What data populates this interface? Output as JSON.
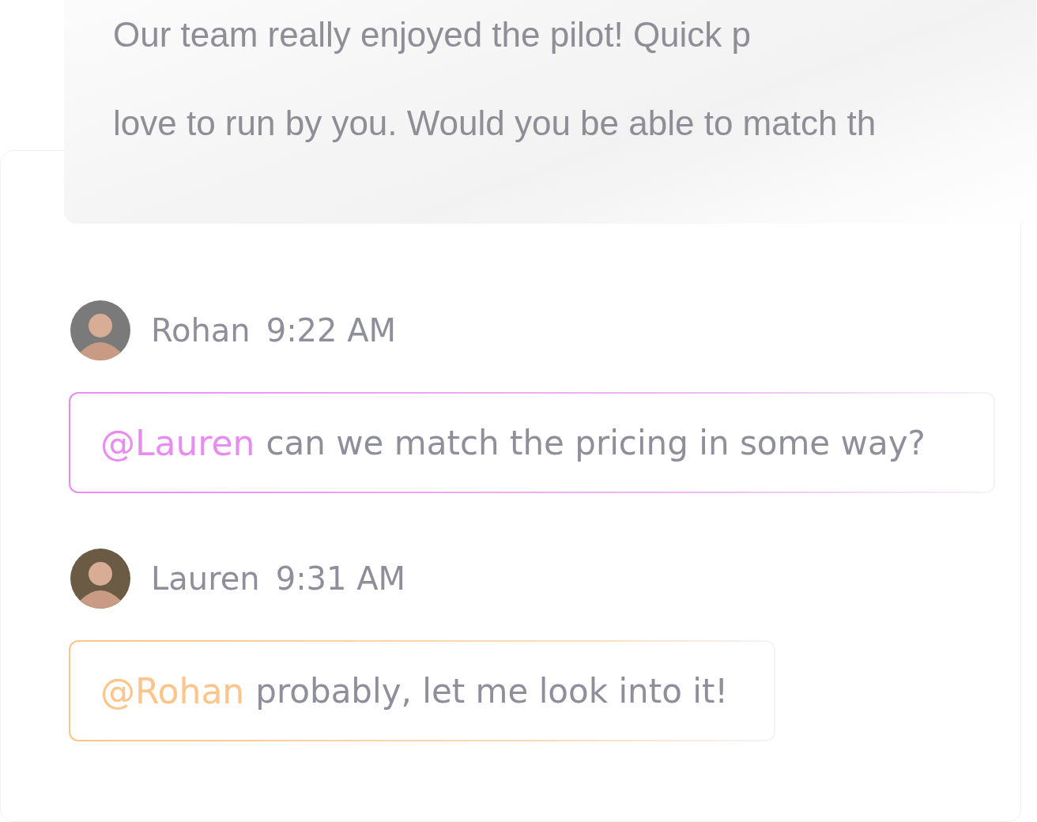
{
  "quoted_message": {
    "lines": [
      "Our team really enjoyed the pilot! Quick p",
      "love to run by you. Would you be able to match th"
    ]
  },
  "messages": [
    {
      "author": "Rohan",
      "time": "9:22 AM",
      "mention": "@Lauren",
      "text": "can we match the pricing in some way?",
      "color": "#e98cf2"
    },
    {
      "author": "Lauren",
      "time": "9:31 AM",
      "mention": "@Rohan",
      "text": "probably, let me look into it!",
      "color": "#fec488"
    }
  ]
}
